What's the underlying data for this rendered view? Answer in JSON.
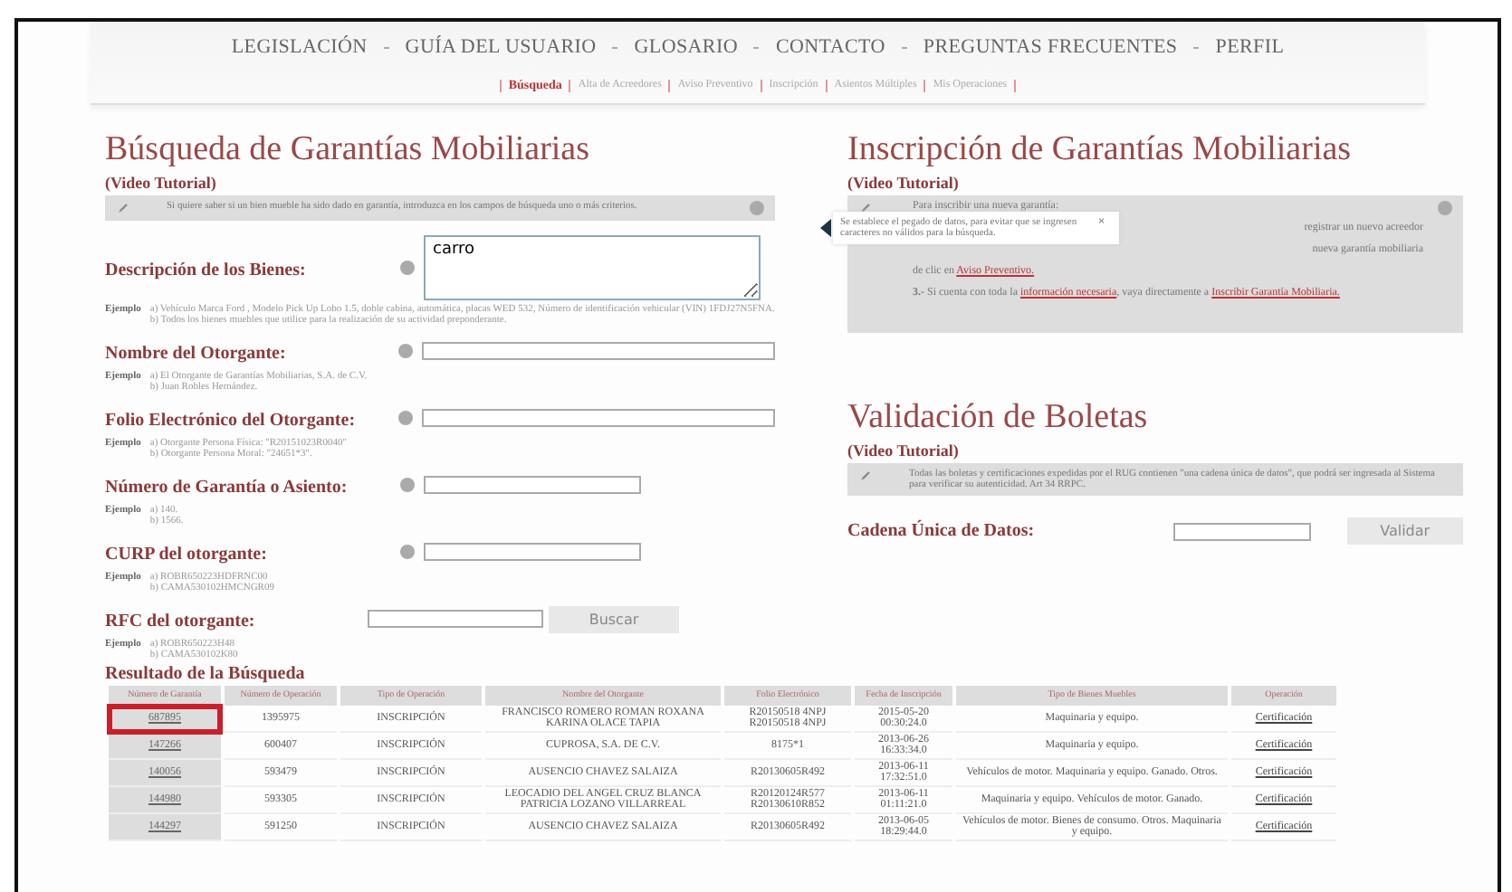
{
  "nav": [
    "LEGISLACIÓN",
    "GUÍA DEL USUARIO",
    "GLOSARIO",
    "CONTACTO",
    "PREGUNTAS FRECUENTES",
    "PERFIL"
  ],
  "subnav": [
    {
      "label": "Búsqueda",
      "selected": true
    },
    {
      "label": "Alta de Acreedores",
      "selected": false
    },
    {
      "label": "Aviso Preventivo",
      "selected": false
    },
    {
      "label": "Inscripción",
      "selected": false
    },
    {
      "label": "Asientos Múltiples",
      "selected": false
    },
    {
      "label": "Mis Operaciones",
      "selected": false
    }
  ],
  "search": {
    "title": "Búsqueda de Garantías Mobiliarias",
    "tutorial": "(Video Tutorial)",
    "info": "Si quiere saber si un bien mueble ha sido dado en garantía, introduzca en los campos de búsqueda uno o más criterios.",
    "fields": [
      {
        "label": "Descripción de los Bienes:",
        "kind": "textarea",
        "value": "carro",
        "example_label": "Ejemplo",
        "examples": [
          "a) Vehículo Marca Ford , Modelo Pick Up Lobo 1.5, doble cabina, automática, placas WED 532, Número de identificación vehicular (VIN) 1FDJ27N5FNA.",
          "b) Todos los bienes muebles que utilice para la realización de su actividad preponderante."
        ]
      },
      {
        "label": "Nombre del Otorgante:",
        "kind": "input",
        "example_label": "Ejemplo",
        "examples": [
          "a) El Otorgante de Garantías Mobiliarias, S.A. de C.V.",
          "b) Juan Robles Hernández."
        ]
      },
      {
        "label": "Folio Electrónico del Otorgante:",
        "kind": "input",
        "example_label": "Ejemplo",
        "examples": [
          "a) Otorgante Persona Física: \"R20151023R0040\"",
          "b) Otorgante Persona Moral: \"24651*3\"."
        ]
      },
      {
        "label": "Número de Garantía o Asiento:",
        "kind": "short",
        "example_label": "Ejemplo",
        "examples": [
          "a) 140.",
          "b) 1566."
        ]
      },
      {
        "label": "CURP del otorgante:",
        "kind": "short",
        "example_label": "Ejemplo",
        "examples": [
          "a) ROBR650223HDFRNC00",
          "b) CAMA530102HMCNGR09"
        ]
      },
      {
        "label": "RFC del otorgante:",
        "kind": "button",
        "button": "Buscar",
        "example_label": "Ejemplo",
        "examples": [
          "a) ROBR650223H48",
          "b) CAMA530102K80"
        ]
      }
    ]
  },
  "inscription": {
    "title": "Inscripción de Garantías Mobiliarias",
    "tutorial": "(Video Tutorial)",
    "lines": [
      [
        {
          "text": "Para inscribir una nueva garantía:"
        }
      ],
      [
        {
          "text": "registrar un nuevo acreedor"
        }
      ],
      [
        {
          "text": "nueva garantía mobiliaria"
        }
      ],
      [
        {
          "text": "de clic en "
        },
        {
          "text": "Aviso Preventivo.",
          "link": true
        }
      ],
      [
        {
          "text": "3.-",
          "bold": true
        },
        {
          "text": " Si cuenta con toda la "
        },
        {
          "text": "información necesaria",
          "link": true
        },
        {
          "text": ", vaya directamente a "
        },
        {
          "text": "Inscribir Garantía Mobiliaria.",
          "link": true
        }
      ]
    ],
    "tooltip": {
      "text": "Se establece el pegado de datos, para evitar que se ingresen caracteres no válidos para la búsqueda.",
      "close": "×"
    }
  },
  "validation": {
    "title": "Validación de Boletas",
    "tutorial": "(Video Tutorial)",
    "info": "Todas las boletas y certificaciones expedidas por el RUG contienen \"una cadena única de datos\", que podrá ser ingresada al Sistema para verificar su autenticidad. Art 34 RRPC.",
    "label": "Cadena Única de Datos:",
    "button": "Validar"
  },
  "results": {
    "title": "Resultado de la Búsqueda",
    "columns": [
      "Número de Garantía",
      "Número de Operación",
      "Tipo de Operación",
      "Nombre del Otorgante",
      "Folio Electrónico",
      "Fecha de Inscripción",
      "Tipo de Bienes Muebles",
      "Operación"
    ],
    "rows": [
      {
        "highlighted": true,
        "cells": [
          "687895",
          "1395975",
          "INSCRIPCIÓN",
          "FRANCISCO ROMERO ROMAN ROXANA KARINA OLACE TAPIA",
          "R20150518 4NPJ R20150518 4NPJ",
          "2015-05-20 00:30:24.0",
          "Maquinaria y equipo.",
          "Certificación"
        ]
      },
      {
        "highlighted": false,
        "cells": [
          "147266",
          "600407",
          "INSCRIPCIÓN",
          "CUPROSA, S.A. DE C.V.",
          "8175*1",
          "2013-06-26 16:33:34.0",
          "Maquinaria y equipo.",
          "Certificación"
        ]
      },
      {
        "highlighted": false,
        "cells": [
          "140056",
          "593479",
          "INSCRIPCIÓN",
          "AUSENCIO CHAVEZ SALAIZA",
          "R20130605R492",
          "2013-06-11 17:32:51.0",
          "Vehículos de motor. Maquinaria y equipo. Ganado. Otros.",
          "Certificación"
        ]
      },
      {
        "highlighted": false,
        "cells": [
          "144980",
          "593305",
          "INSCRIPCIÓN",
          "LEOCADIO DEL ANGEL CRUZ BLANCA PATRICIA LOZANO VILLARREAL",
          "R20120124R577 R20130610R852",
          "2013-06-11 01:11:21.0",
          "Maquinaria y equipo. Vehículos de motor. Ganado.",
          "Certificación"
        ]
      },
      {
        "highlighted": false,
        "cells": [
          "144297",
          "591250",
          "INSCRIPCIÓN",
          "AUSENCIO CHAVEZ SALAIZA",
          "R20130605R492",
          "2013-06-05 18:29:44.0",
          "Vehículos de motor. Bienes de consumo. Otros. Maquinaria y equipo.",
          "Certificación"
        ]
      }
    ]
  }
}
